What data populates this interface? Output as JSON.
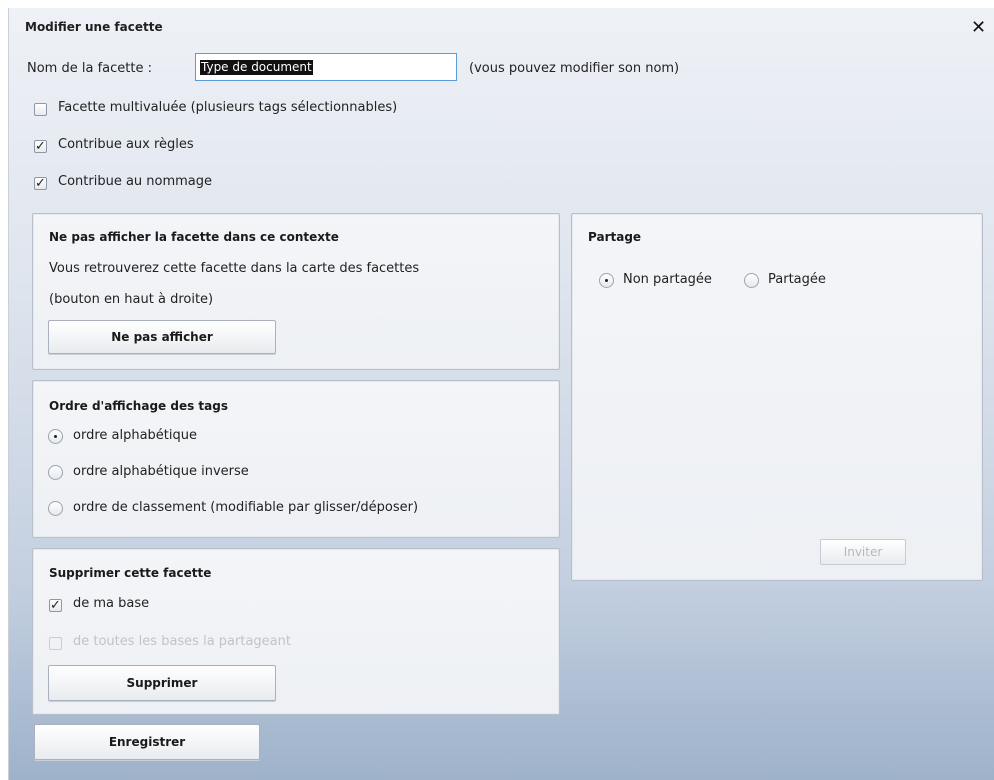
{
  "dialog": {
    "title": "Modifier une facette",
    "close_icon": "close-icon"
  },
  "name_field": {
    "label": "Nom de la facette :",
    "value": "Type de document",
    "hint": "(vous pouvez modifier son nom)"
  },
  "options": {
    "multivalued": {
      "label": "Facette multivaluée (plusieurs tags sélectionnables)",
      "checked": false
    },
    "rules": {
      "label": "Contribue aux règles",
      "checked": true
    },
    "naming": {
      "label": "Contribue au nommage",
      "checked": true
    }
  },
  "hide_panel": {
    "title": "Ne pas afficher la facette dans ce contexte",
    "line1": "Vous retrouverez cette facette dans la carte des facettes",
    "line2": "(bouton en haut à droite)",
    "button": "Ne pas afficher"
  },
  "order_panel": {
    "title": "Ordre d'affichage des tags",
    "options": [
      {
        "label": "ordre alphabétique",
        "selected": true
      },
      {
        "label": "ordre alphabétique inverse",
        "selected": false
      },
      {
        "label": "ordre de classement (modifiable par glisser/déposer)",
        "selected": false
      }
    ]
  },
  "delete_panel": {
    "title": "Supprimer cette facette",
    "from_my_base": {
      "label": "de ma base",
      "checked": true
    },
    "from_all_bases": {
      "label": "de toutes les bases la partageant",
      "checked": false,
      "disabled": true
    },
    "button": "Supprimer"
  },
  "share_panel": {
    "title": "Partage",
    "options": [
      {
        "label": "Non partagée",
        "selected": true
      },
      {
        "label": "Partagée",
        "selected": false
      }
    ],
    "invite_button": "Inviter"
  },
  "save_button": "Enregistrer"
}
